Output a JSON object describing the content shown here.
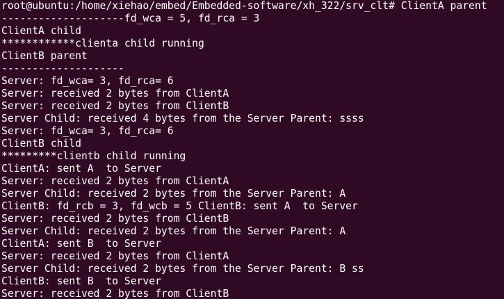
{
  "terminal": {
    "background": "#300a24",
    "foreground": "#ffffff",
    "lines": [
      "root@ubuntu:/home/xiehao/embed/Embedded-software/xh_322/srv_clt# ClientA parent",
      "--------------------fd_wca = 5, fd_rca = 3",
      "ClientA child",
      "************clienta child running",
      "ClientB parent",
      "--------------------",
      "Server: fd_wca= 3, fd_rca= 6",
      "Server: received 2 bytes from ClientA",
      "Server: received 2 bytes from ClientB",
      "Server Child: received 4 bytes from the Server Parent: ssss",
      "Server: fd_wca= 3, fd_rca= 6",
      "ClientB child",
      "*********clientb child running",
      "ClientA: sent A  to Server",
      "Server: received 2 bytes from ClientA",
      "Server Child: received 2 bytes from the Server Parent: A",
      "ClientB: fd_rcb = 3, fd_wcb = 5 ClientB: sent A  to Server",
      "Server: received 2 bytes from ClientB",
      "Server Child: received 2 bytes from the Server Parent: A",
      "ClientA: sent B  to Server",
      "Server: received 2 bytes from ClientA",
      "Server Child: received 2 bytes from the Server Parent: B ss",
      "ClientB: sent B  to Server",
      "Server: received 2 bytes from ClientB"
    ]
  }
}
